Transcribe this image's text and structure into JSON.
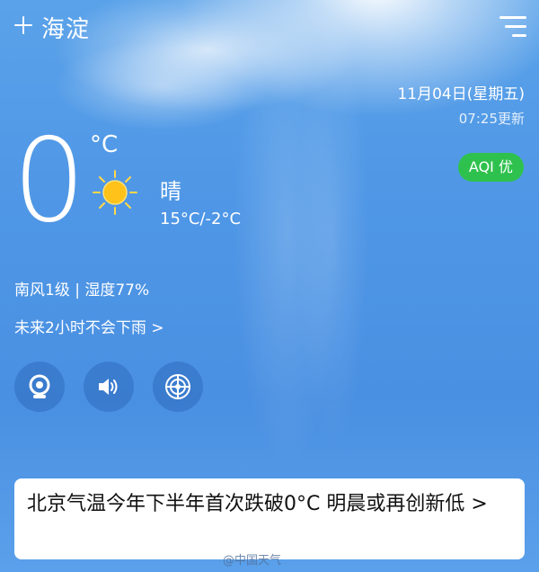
{
  "header": {
    "city": "海淀",
    "add_icon": "plus-icon",
    "menu_icon": "menu-icon"
  },
  "meta": {
    "date": "11月04日(星期五)",
    "updated": "07:25更新",
    "aqi_label": "AQI 优",
    "aqi_color": "#2fc14d"
  },
  "current": {
    "temperature": "0",
    "unit": "°C",
    "condition": "晴",
    "condition_icon": "sun-icon",
    "range": "15°C/-2°C",
    "wind_humidity": "南风1级 | 湿度77%",
    "rain_forecast": "未来2小时不会下雨 >"
  },
  "actions": [
    {
      "icon": "camera-icon"
    },
    {
      "icon": "speaker-icon"
    },
    {
      "icon": "radar-icon"
    }
  ],
  "news": {
    "headline": "北京气温今年下半年首次跌破0°C 明晨或再创新低 >"
  },
  "watermark": {
    "text": "@中国天气"
  }
}
